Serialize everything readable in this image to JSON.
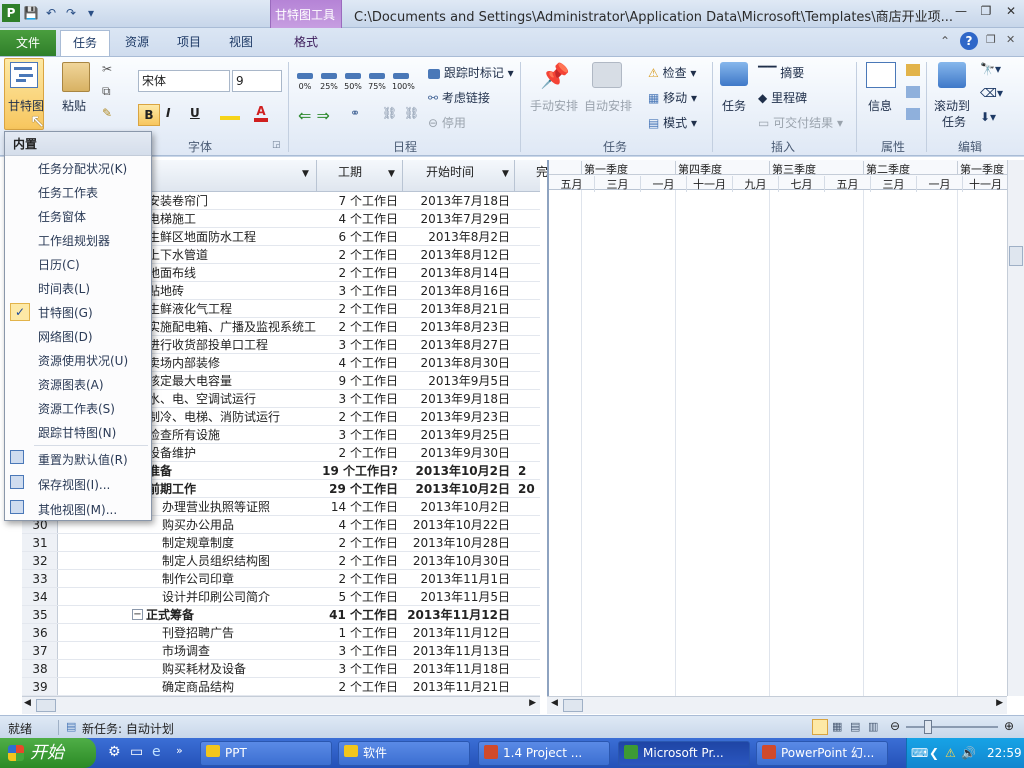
{
  "window": {
    "title": "C:\\Documents and Settings\\Administrator\\Application Data\\Microsoft\\Templates\\商店开业项...",
    "context_tab_group": "甘特图工具",
    "controls": {
      "minimize": "—",
      "restore": "❐",
      "close": "✕"
    }
  },
  "qat": {
    "app_icon": "P",
    "save": "💾",
    "undo": "↶",
    "redo": "↷",
    "customize": "▾"
  },
  "tabs": {
    "file": "文件",
    "task": "任务",
    "resource": "资源",
    "project": "项目",
    "view": "视图",
    "format": "格式"
  },
  "ribbon": {
    "gantt_button": "甘特图",
    "paste": "粘贴",
    "font_name": "宋体",
    "font_size": "9",
    "bold": "B",
    "italic": "I",
    "underline": "U",
    "font_color": "A",
    "pct": [
      "0%",
      "25%",
      "50%",
      "75%",
      "100%"
    ],
    "track": "跟踪时标记",
    "respect_links": "考虑链接",
    "inactivate": "停用",
    "manual": "手动安排",
    "auto": "自动安排",
    "inspect": "检查",
    "move": "移动",
    "mode": "模式",
    "task_btn": "任务",
    "summary": "摘要",
    "milestone": "里程碑",
    "deliverable": "可交付结果",
    "info": "信息",
    "scroll_to_task_1": "滚动到",
    "scroll_to_task_2": "任务",
    "groups": {
      "font": "字体",
      "schedule": "日程",
      "tasks": "任务",
      "insert": "插入",
      "properties": "属性",
      "edit": "编辑"
    }
  },
  "menu": {
    "header": "内置",
    "items": [
      "任务分配状况(K)",
      "任务工作表",
      "任务窗体",
      "工作组规划器",
      "日历(C)",
      "时间表(L)",
      "甘特图(G)",
      "网络图(D)",
      "资源使用状况(U)",
      "资源图表(A)",
      "资源工作表(S)",
      "跟踪甘特图(N)"
    ],
    "checked_item": "甘特图(G)",
    "actions": [
      "重置为默认值(R)",
      "保存视图(I)...",
      "其他视图(M)..."
    ]
  },
  "table": {
    "headers": {
      "duration": "工期",
      "start": "开始时间",
      "extra": "完"
    },
    "rows": [
      {
        "id": "",
        "name": "安装卷帘门",
        "dur": "7 个工作日",
        "start": "2013年7月18日",
        "bold": false
      },
      {
        "id": "",
        "name": "电梯施工",
        "dur": "4 个工作日",
        "start": "2013年7月29日",
        "bold": false
      },
      {
        "id": "",
        "name": "生鲜区地面防水工程",
        "dur": "6 个工作日",
        "start": "2013年8月2日",
        "bold": false
      },
      {
        "id": "",
        "name": "上下水管道",
        "dur": "2 个工作日",
        "start": "2013年8月12日",
        "bold": false
      },
      {
        "id": "",
        "name": "地面布线",
        "dur": "2 个工作日",
        "start": "2013年8月14日",
        "bold": false
      },
      {
        "id": "",
        "name": "贴地砖",
        "dur": "3 个工作日",
        "start": "2013年8月16日",
        "bold": false
      },
      {
        "id": "",
        "name": "生鲜液化气工程",
        "dur": "2 个工作日",
        "start": "2013年8月21日",
        "bold": false
      },
      {
        "id": "",
        "name": "实施配电箱、广播及监视系统工",
        "dur": "2 个工作日",
        "start": "2013年8月23日",
        "bold": false
      },
      {
        "id": "",
        "name": "进行收货部投单口工程",
        "dur": "3 个工作日",
        "start": "2013年8月27日",
        "bold": false
      },
      {
        "id": "",
        "name": "卖场内部装修",
        "dur": "4 个工作日",
        "start": "2013年8月30日",
        "bold": false
      },
      {
        "id": "",
        "name": "核定最大电容量",
        "dur": "9 个工作日",
        "start": "2013年9月5日",
        "bold": false
      },
      {
        "id": "",
        "name": "水、电、空调试运行",
        "dur": "3 个工作日",
        "start": "2013年9月18日",
        "bold": false
      },
      {
        "id": "",
        "name": "制冷、电梯、消防试运行",
        "dur": "2 个工作日",
        "start": "2013年9月23日",
        "bold": false
      },
      {
        "id": "",
        "name": "检查所有设施",
        "dur": "3 个工作日",
        "start": "2013年9月25日",
        "bold": false
      },
      {
        "id": "",
        "name": "设备维护",
        "dur": "2 个工作日",
        "start": "2013年9月30日",
        "bold": false
      },
      {
        "id": "",
        "name": "准备",
        "dur": "19 个工作日?",
        "start": "2013年10月2日",
        "bold": true,
        "extra": "2"
      },
      {
        "id": "",
        "name": "前期工作",
        "dur": "29 个工作日",
        "start": "2013年10月2日",
        "bold": true,
        "extra": "20"
      },
      {
        "id": "",
        "name": "办理营业执照等证照",
        "dur": "14 个工作日",
        "start": "2013年10月2日",
        "bold": false,
        "indent": true
      },
      {
        "id": "30",
        "name": "购买办公用品",
        "dur": "4 个工作日",
        "start": "2013年10月22日",
        "bold": false,
        "indent": true
      },
      {
        "id": "31",
        "name": "制定规章制度",
        "dur": "2 个工作日",
        "start": "2013年10月28日",
        "bold": false,
        "indent": true
      },
      {
        "id": "32",
        "name": "制定人员组织结构图",
        "dur": "2 个工作日",
        "start": "2013年10月30日",
        "bold": false,
        "indent": true
      },
      {
        "id": "33",
        "name": "制作公司印章",
        "dur": "2 个工作日",
        "start": "2013年11月1日",
        "bold": false,
        "indent": true
      },
      {
        "id": "34",
        "name": "设计并印刷公司简介",
        "dur": "5 个工作日",
        "start": "2013年11月5日",
        "bold": false,
        "indent": true
      },
      {
        "id": "35",
        "name": "正式筹备",
        "dur": "41 个工作日",
        "start": "2013年11月12日",
        "bold": true,
        "collapse": "−"
      },
      {
        "id": "36",
        "name": "刊登招聘广告",
        "dur": "1 个工作日",
        "start": "2013年11月12日",
        "bold": false,
        "indent": true
      },
      {
        "id": "37",
        "name": "市场调查",
        "dur": "3 个工作日",
        "start": "2013年11月13日",
        "bold": false,
        "indent": true
      },
      {
        "id": "38",
        "name": "购买耗材及设备",
        "dur": "3 个工作日",
        "start": "2013年11月18日",
        "bold": false,
        "indent": true
      },
      {
        "id": "39",
        "name": "确定商品结构",
        "dur": "2 个工作日",
        "start": "2013年11月21日",
        "bold": false,
        "indent": true
      }
    ]
  },
  "timeline": {
    "quarters": [
      "第一季度",
      "第四季度",
      "第三季度",
      "第二季度",
      "第一季度"
    ],
    "months": [
      "五月",
      "三月",
      "一月",
      "十一月",
      "九月",
      "七月",
      "五月",
      "三月",
      "一月",
      "十一月"
    ]
  },
  "status": {
    "ready": "就绪",
    "new_task": "新任务: 自动计划"
  },
  "taskbar": {
    "start": "开始",
    "buttons": [
      "PPT",
      "软件",
      "1.4 Project ...",
      "Microsoft Pr...",
      "PowerPoint 幻..."
    ],
    "clock": "22:59"
  }
}
